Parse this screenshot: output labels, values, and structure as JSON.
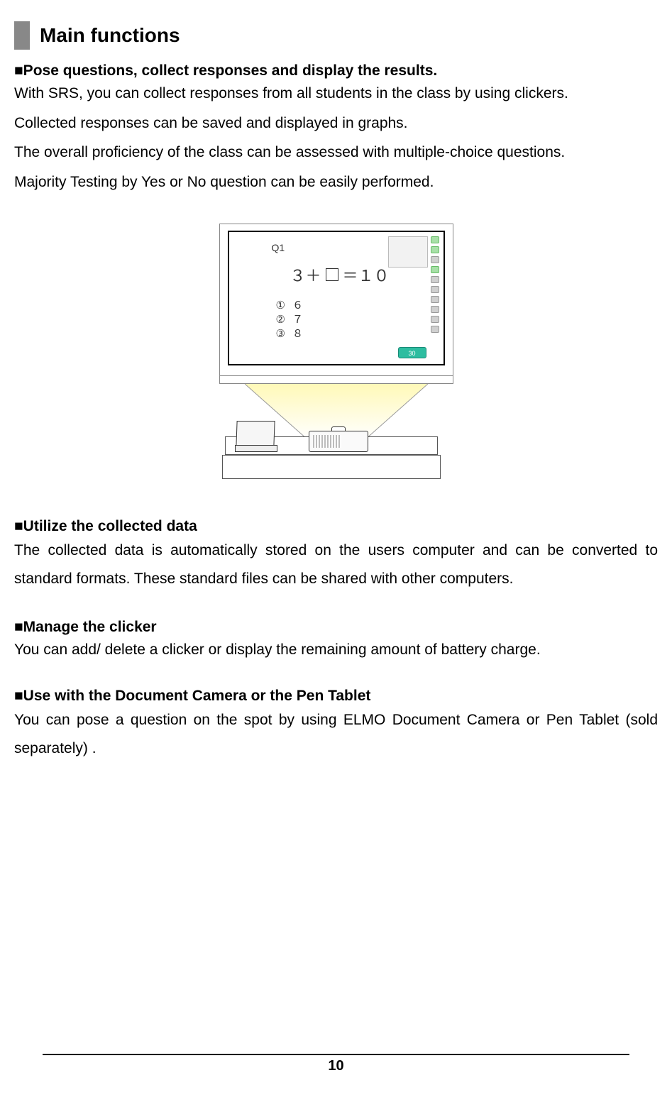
{
  "title": "Main functions",
  "sections": [
    {
      "heading": "■Pose questions, collect responses and display the results.",
      "paragraphs": [
        "With SRS, you can collect responses from all students in the class by using clickers.",
        "Collected responses can be saved and displayed in graphs.",
        "The overall proficiency of the class can be assessed with multiple-choice questions.",
        "Majority Testing by Yes or No question can be easily performed."
      ]
    },
    {
      "heading": "■Utilize the collected data",
      "paragraphs": [
        "The collected data is automatically stored on the users computer and can be converted to standard formats. These standard files can be shared with other computers."
      ]
    },
    {
      "heading": "■Manage the clicker",
      "paragraphs": [
        "You can add/ delete a clicker or display the remaining amount of battery charge."
      ]
    },
    {
      "heading": "■Use with the Document Camera or the Pen Tablet",
      "paragraphs": [
        "You can pose a question on the spot by using ELMO Document Camera or Pen Tablet (sold separately) ."
      ]
    }
  ],
  "illustration": {
    "question_label": "Q1",
    "equation_left": "３＋",
    "equation_right": "＝１０",
    "choices": [
      {
        "num": "①",
        "val": "６"
      },
      {
        "num": "②",
        "val": "７"
      },
      {
        "num": "③",
        "val": "８"
      }
    ],
    "counter": "30"
  },
  "page_number": "10"
}
